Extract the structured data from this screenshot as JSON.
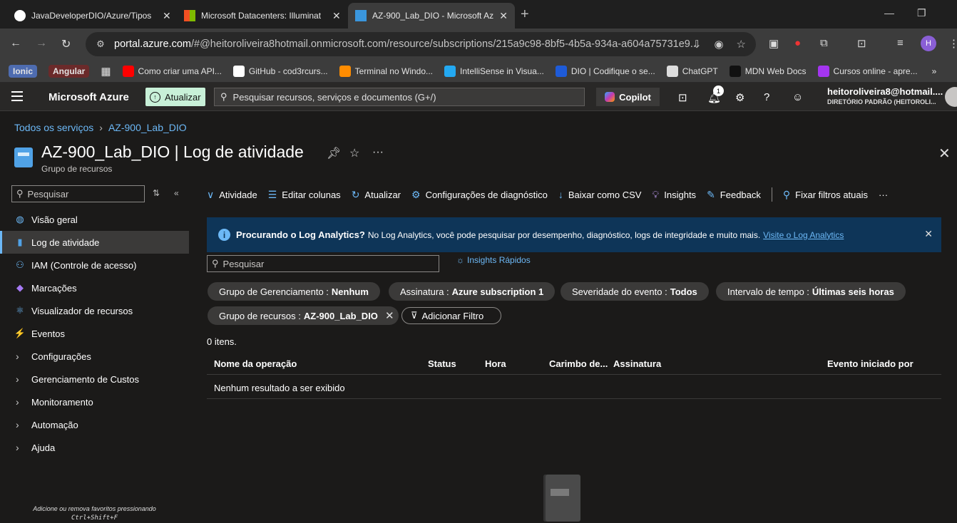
{
  "browser": {
    "tabs": [
      {
        "title": "JavaDeveloperDIO/Azure/Tipos",
        "icon": "github-icon"
      },
      {
        "title": "Microsoft Datacenters: Illuminat",
        "icon": "microsoft-icon"
      },
      {
        "title": "AZ-900_Lab_DIO - Microsoft Az",
        "icon": "azure-icon",
        "active": true
      }
    ],
    "url_host": "portal.azure.com",
    "url_rest": "/#@heitoroliveira8hotmail.onmicrosoft.com/resource/subscriptions/215a9c98-8bf5-4b5a-934a-a604a75731e9...",
    "profile_initial": "H",
    "bookmarks": [
      {
        "label": "Ionic",
        "kind": "chip",
        "color": "#4e6cb0"
      },
      {
        "label": "Angular",
        "kind": "chip",
        "color": "#6b2a2a"
      },
      {
        "label": "",
        "kind": "apps"
      },
      {
        "label": "Como criar uma API...",
        "color": "#ff0000"
      },
      {
        "label": "GitHub - cod3rcurs...",
        "color": "#ffffff"
      },
      {
        "label": "Terminal no Windo...",
        "color": "#ff8c00"
      },
      {
        "label": "IntelliSense in Visua...",
        "color": "#23a9f2"
      },
      {
        "label": "DIO | Codifique o se...",
        "color": "#1e5bd8"
      },
      {
        "label": "ChatGPT",
        "color": "#dddddd"
      },
      {
        "label": "MDN Web Docs",
        "color": "#111111"
      },
      {
        "label": "Cursos online - apre...",
        "color": "#a435f0"
      }
    ]
  },
  "azure": {
    "brand": "Microsoft Azure",
    "update_label": "Atualizar",
    "search_placeholder": "Pesquisar recursos, serviços e documentos (G+/)",
    "copilot_label": "Copilot",
    "notif_count": "1",
    "account_name": "heitoroliveira8@hotmail....",
    "account_dir": "DIRETÓRIO PADRÃO (HEITOROLI..."
  },
  "breadcrumb": [
    "Todos os serviços",
    "AZ-900_Lab_DIO"
  ],
  "page": {
    "title": "AZ-900_Lab_DIO | Log de atividade",
    "subtitle": "Grupo de recursos"
  },
  "leftnav": {
    "search_placeholder": "Pesquisar",
    "items": [
      {
        "label": "Visão geral",
        "icon": "overview-icon"
      },
      {
        "label": "Log de atividade",
        "icon": "activity-log-icon",
        "selected": true
      },
      {
        "label": "IAM (Controle de acesso)",
        "icon": "iam-icon"
      },
      {
        "label": "Marcações",
        "icon": "tag-icon"
      },
      {
        "label": "Visualizador de recursos",
        "icon": "resource-visualizer-icon"
      },
      {
        "label": "Eventos",
        "icon": "lightning-icon"
      },
      {
        "label": "Configurações",
        "expandable": true
      },
      {
        "label": "Gerenciamento de Custos",
        "expandable": true
      },
      {
        "label": "Monitoramento",
        "expandable": true
      },
      {
        "label": "Automação",
        "expandable": true
      },
      {
        "label": "Ajuda",
        "expandable": true
      }
    ],
    "fav_hint_line1": "Adicione ou remova favoritos pressionando",
    "fav_hint_line2": "Ctrl+Shift+F"
  },
  "commandbar": [
    {
      "label": "Atividade",
      "icon": "chevron-down-icon"
    },
    {
      "label": "Editar colunas",
      "icon": "columns-icon"
    },
    {
      "label": "Atualizar",
      "icon": "refresh-icon"
    },
    {
      "label": "Configurações de diagnóstico",
      "icon": "gear-icon"
    },
    {
      "label": "Baixar como CSV",
      "icon": "download-icon"
    },
    {
      "label": "Insights",
      "icon": "bulb-icon"
    },
    {
      "label": "Feedback",
      "icon": "feedback-icon"
    },
    {
      "label": "Fixar filtros atuais",
      "icon": "pin-icon"
    }
  ],
  "banner": {
    "heading": "Procurando o Log Analytics?",
    "text": "No Log Analytics, você pode pesquisar por desempenho, diagnóstico, logs de integridade e muito mais.",
    "link": "Visite o Log Analytics"
  },
  "grid_search_placeholder": "Pesquisar",
  "quick_insights": "Insights Rápidos",
  "filters": [
    {
      "key": "Grupo de Gerenciamento :",
      "value": "Nenhum"
    },
    {
      "key": "Assinatura :",
      "value": "Azure subscription 1"
    },
    {
      "key": "Severidade do evento :",
      "value": "Todos"
    },
    {
      "key": "Intervalo de tempo :",
      "value": "Últimas seis horas"
    },
    {
      "key": "Grupo de recursos :",
      "value": "AZ-900_Lab_DIO"
    }
  ],
  "add_filter": "Adicionar Filtro",
  "item_count": "0 itens.",
  "table": {
    "columns": [
      "Nome da operação",
      "Status",
      "Hora",
      "Carimbo de...",
      "Assinatura",
      "Evento iniciado por"
    ],
    "empty_message": "Nenhum resultado a ser exibido"
  }
}
